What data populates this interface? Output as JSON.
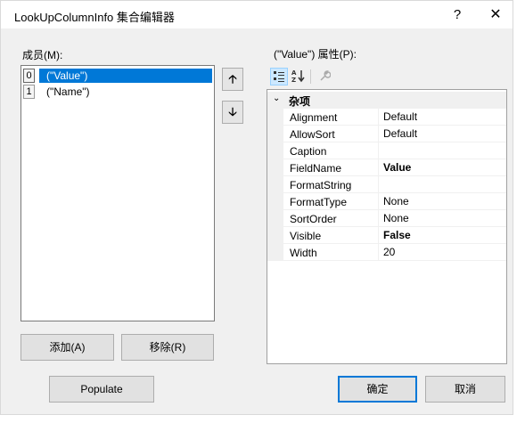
{
  "window": {
    "title": "LookUpColumnInfo 集合编辑器",
    "help_label": "?",
    "close_label": "✕"
  },
  "members": {
    "label": "成员(M):",
    "items": [
      {
        "index": "0",
        "text": "(\"Value\")",
        "selected": true
      },
      {
        "index": "1",
        "text": "(\"Name\")",
        "selected": false
      }
    ],
    "move_up_label": "🡡",
    "move_down_label": "🡣",
    "add_label": "添加(A)",
    "remove_label": "移除(R)"
  },
  "properties": {
    "label": "(\"Value\") 属性(P):",
    "category": "杂项",
    "rows": [
      {
        "name": "Alignment",
        "value": "Default",
        "bold": false
      },
      {
        "name": "AllowSort",
        "value": "Default",
        "bold": false
      },
      {
        "name": "Caption",
        "value": "",
        "bold": false
      },
      {
        "name": "FieldName",
        "value": "Value",
        "bold": true
      },
      {
        "name": "FormatString",
        "value": "",
        "bold": false
      },
      {
        "name": "FormatType",
        "value": "None",
        "bold": false
      },
      {
        "name": "SortOrder",
        "value": "None",
        "bold": false
      },
      {
        "name": "Visible",
        "value": "False",
        "bold": true
      },
      {
        "name": "Width",
        "value": "20",
        "bold": false
      }
    ]
  },
  "footer": {
    "populate_label": "Populate",
    "ok_label": "确定",
    "cancel_label": "取消"
  },
  "icons": [
    "categorized-icon",
    "alphabetical-icon",
    "property-pages-icon",
    "collapse-icon",
    "up-arrow-icon",
    "down-arrow-icon"
  ]
}
